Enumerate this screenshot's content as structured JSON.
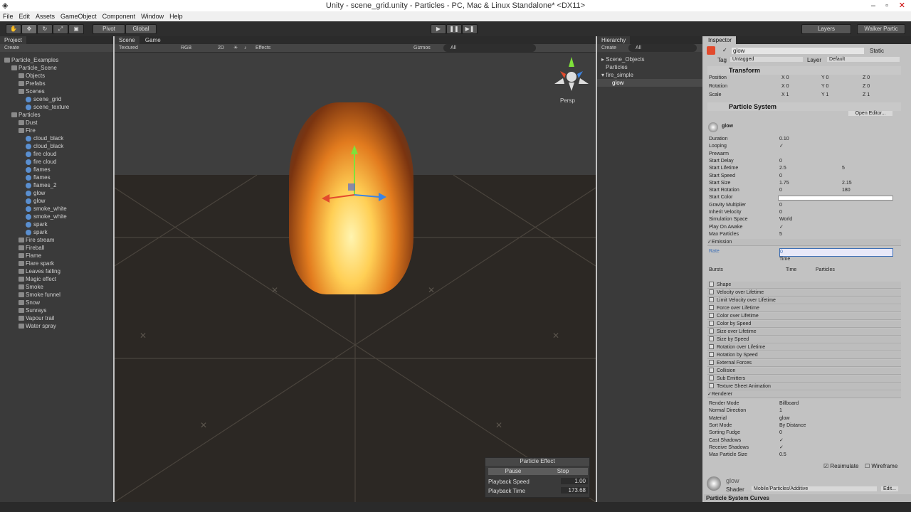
{
  "window": {
    "title": "Unity - scene_grid.unity - Particles - PC, Mac & Linux Standalone* <DX11>"
  },
  "menu": [
    "File",
    "Edit",
    "Assets",
    "GameObject",
    "Component",
    "Window",
    "Help"
  ],
  "toolbar": {
    "pivot": "Pivot",
    "global": "Global",
    "layers": "Layers",
    "layout": "Walker Partic"
  },
  "project": {
    "tab": "Project",
    "create": "Create",
    "items": [
      {
        "label": "Particle_Examples",
        "indent": 0,
        "fold": true
      },
      {
        "label": "Particle_Scene",
        "indent": 1,
        "fold": true
      },
      {
        "label": "Objects",
        "indent": 2,
        "fold": true
      },
      {
        "label": "Prefabs",
        "indent": 2,
        "fold": true
      },
      {
        "label": "Scenes",
        "indent": 2,
        "fold": true
      },
      {
        "label": "scene_grid",
        "indent": 3,
        "fold": false
      },
      {
        "label": "scene_texture",
        "indent": 3,
        "fold": false
      },
      {
        "label": "Particles",
        "indent": 1,
        "fold": true
      },
      {
        "label": "Dust",
        "indent": 2,
        "fold": true
      },
      {
        "label": "Fire",
        "indent": 2,
        "fold": true
      },
      {
        "label": "cloud_black",
        "indent": 3,
        "fold": false
      },
      {
        "label": "cloud_black",
        "indent": 3,
        "fold": false
      },
      {
        "label": "fire cloud",
        "indent": 3,
        "fold": false
      },
      {
        "label": "fire cloud",
        "indent": 3,
        "fold": false
      },
      {
        "label": "flames",
        "indent": 3,
        "fold": false
      },
      {
        "label": "flames",
        "indent": 3,
        "fold": false
      },
      {
        "label": "flames_2",
        "indent": 3,
        "fold": false
      },
      {
        "label": "glow",
        "indent": 3,
        "fold": false
      },
      {
        "label": "glow",
        "indent": 3,
        "fold": false
      },
      {
        "label": "smoke_white",
        "indent": 3,
        "fold": false
      },
      {
        "label": "smoke_white",
        "indent": 3,
        "fold": false
      },
      {
        "label": "spark",
        "indent": 3,
        "fold": false
      },
      {
        "label": "spark",
        "indent": 3,
        "fold": false
      },
      {
        "label": "Fire stream",
        "indent": 2,
        "fold": true
      },
      {
        "label": "Fireball",
        "indent": 2,
        "fold": true
      },
      {
        "label": "Flame",
        "indent": 2,
        "fold": true
      },
      {
        "label": "Flare spark",
        "indent": 2,
        "fold": true
      },
      {
        "label": "Leaves falling",
        "indent": 2,
        "fold": true
      },
      {
        "label": "Magic effect",
        "indent": 2,
        "fold": true
      },
      {
        "label": "Smoke",
        "indent": 2,
        "fold": true
      },
      {
        "label": "Smoke funnel",
        "indent": 2,
        "fold": true
      },
      {
        "label": "Snow",
        "indent": 2,
        "fold": true
      },
      {
        "label": "Sunrays",
        "indent": 2,
        "fold": true
      },
      {
        "label": "Vapour trail",
        "indent": 2,
        "fold": true
      },
      {
        "label": "Water spray",
        "indent": 2,
        "fold": true
      }
    ]
  },
  "scene": {
    "tab_scene": "Scene",
    "tab_game": "Game",
    "shading": "Textured",
    "rgb": "RGB",
    "mode2d": "2D",
    "effects": "Effects",
    "gizmos": "Gizmos",
    "search": "All",
    "persp": "Persp"
  },
  "hierarchy": {
    "tab": "Hierarchy",
    "create": "Create",
    "search": "All",
    "items": [
      "Scene_Objects",
      "Particles",
      "fire_simple",
      "glow"
    ]
  },
  "inspector": {
    "tab": "Inspector",
    "name": "glow",
    "static": "Static",
    "tag_label": "Tag",
    "tag": "Untagged",
    "layer_label": "Layer",
    "layer": "Default",
    "transform": {
      "title": "Transform",
      "rows": [
        {
          "label": "Position",
          "x": "0",
          "y": "0",
          "z": "0"
        },
        {
          "label": "Rotation",
          "x": "0",
          "y": "0",
          "z": "0"
        },
        {
          "label": "Scale",
          "x": "1",
          "y": "1",
          "z": "1"
        }
      ]
    },
    "ps_title": "Particle System",
    "open_editor": "Open Editor...",
    "system_name": "glow",
    "props": [
      {
        "label": "Duration",
        "v": "0.10",
        "v2": ""
      },
      {
        "label": "Looping",
        "v": "✓",
        "v2": ""
      },
      {
        "label": "Prewarm",
        "v": "",
        "v2": ""
      },
      {
        "label": "Start Delay",
        "v": "0",
        "v2": ""
      },
      {
        "label": "Start Lifetime",
        "v": "2.5",
        "v2": "5"
      },
      {
        "label": "Start Speed",
        "v": "0",
        "v2": ""
      },
      {
        "label": "Start Size",
        "v": "1.75",
        "v2": "2.15"
      },
      {
        "label": "Start Rotation",
        "v": "0",
        "v2": "180"
      },
      {
        "label": "Start Color",
        "v": "",
        "v2": ""
      },
      {
        "label": "Gravity Multiplier",
        "v": "0",
        "v2": ""
      },
      {
        "label": "Inherit Velocity",
        "v": "0",
        "v2": ""
      },
      {
        "label": "Simulation Space",
        "v": "World",
        "v2": ""
      },
      {
        "label": "Play On Awake",
        "v": "✓",
        "v2": ""
      },
      {
        "label": "Max Particles",
        "v": "5",
        "v2": ""
      }
    ],
    "emission": {
      "title": "Emission",
      "rate_label": "Rate",
      "rate": "0",
      "time": "Time",
      "bursts": "Bursts",
      "col_time": "Time",
      "col_particles": "Particles"
    },
    "modules": [
      "Shape",
      "Velocity over Lifetime",
      "Limit Velocity over Lifetime",
      "Force over Lifetime",
      "Color over Lifetime",
      "Color by Speed",
      "Size over Lifetime",
      "Size by Speed",
      "Rotation over Lifetime",
      "Rotation by Speed",
      "External Forces",
      "Collision",
      "Sub Emitters",
      "Texture Sheet Animation"
    ],
    "renderer": {
      "title": "Renderer",
      "rows": [
        {
          "label": "Render Mode",
          "v": "Billboard"
        },
        {
          "label": "Normal Direction",
          "v": "1"
        },
        {
          "label": "Material",
          "v": "glow"
        },
        {
          "label": "Sort Mode",
          "v": "By Distance"
        },
        {
          "label": "Sorting Fudge",
          "v": "0"
        },
        {
          "label": "Cast Shadows",
          "v": "✓"
        },
        {
          "label": "Receive Shadows",
          "v": "✓"
        },
        {
          "label": "Max Particle Size",
          "v": "0.5"
        }
      ]
    },
    "resimulate": "Resimulate",
    "wireframe": "Wireframe",
    "material": {
      "name": "glow",
      "shader_label": "Shader",
      "shader": "Mobile/Particles/Additive",
      "edit": "Edit..."
    },
    "curves": "Particle System Curves"
  },
  "particle_effect": {
    "title": "Particle Effect",
    "pause": "Pause",
    "stop": "Stop",
    "speed_label": "Playback Speed",
    "speed": "1.00",
    "time_label": "Playback Time",
    "time": "173.68"
  },
  "colors": {
    "flame_core": "#ffd86a",
    "flame_edge": "#c2450f",
    "selection": "#3d6fb5"
  }
}
